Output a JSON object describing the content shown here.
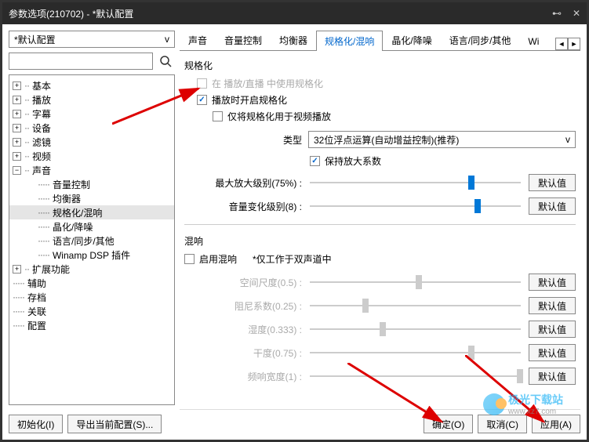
{
  "titlebar": {
    "text": "参数选项(210702) - *默认配置"
  },
  "left": {
    "dropdown": "*默认配置",
    "tree": [
      {
        "label": "基本",
        "type": "parent"
      },
      {
        "label": "播放",
        "type": "parent"
      },
      {
        "label": "字幕",
        "type": "parent"
      },
      {
        "label": "设备",
        "type": "parent"
      },
      {
        "label": "滤镜",
        "type": "parent"
      },
      {
        "label": "视频",
        "type": "parent"
      },
      {
        "label": "声音",
        "type": "parent-open"
      },
      {
        "label": "音量控制",
        "type": "child"
      },
      {
        "label": "均衡器",
        "type": "child"
      },
      {
        "label": "规格化/混响",
        "type": "child-selected"
      },
      {
        "label": "晶化/降噪",
        "type": "child"
      },
      {
        "label": "语言/同步/其他",
        "type": "child"
      },
      {
        "label": "Winamp DSP 插件",
        "type": "child"
      },
      {
        "label": "扩展功能",
        "type": "parent"
      },
      {
        "label": "辅助",
        "type": "parent-noexp"
      },
      {
        "label": "存档",
        "type": "parent-noexp"
      },
      {
        "label": "关联",
        "type": "parent-noexp"
      },
      {
        "label": "配置",
        "type": "parent-noexp"
      }
    ],
    "init_btn": "初始化(I)",
    "export_btn": "导出当前配置(S)..."
  },
  "tabs": {
    "items": [
      "声音",
      "音量控制",
      "均衡器",
      "规格化/混响",
      "晶化/降噪",
      "语言/同步/其他",
      "Wi"
    ],
    "active_index": 3
  },
  "normalize": {
    "group": "规格化",
    "cb1": "在 播放/直播 中使用规格化",
    "cb2": "播放时开启规格化",
    "cb3": "仅将规格化用于视频播放",
    "type_label": "类型",
    "type_value": "32位浮点运算(自动增益控制)(推荐)",
    "keep_coef": "保持放大系数",
    "max_amp_label": "最大放大级别(75%) :",
    "vol_change_label": "音量变化级别(8) :",
    "default_btn": "默认值"
  },
  "reverb": {
    "group": "混响",
    "enable": "启用混响",
    "note": "*仅工作于双声道中",
    "room_label": "空间尺度(0.5) :",
    "damp_label": "阻尼系数(0.25) :",
    "wet_label": "湿度(0.333) :",
    "dry_label": "干度(0.75) :",
    "width_label": "频响宽度(1) :",
    "default_btn": "默认值"
  },
  "footer": {
    "ok": "确定(O)",
    "cancel": "取消(C)",
    "apply": "应用(A)"
  },
  "watermark": {
    "name": "极光下载站",
    "url": "www.xz7.com"
  }
}
